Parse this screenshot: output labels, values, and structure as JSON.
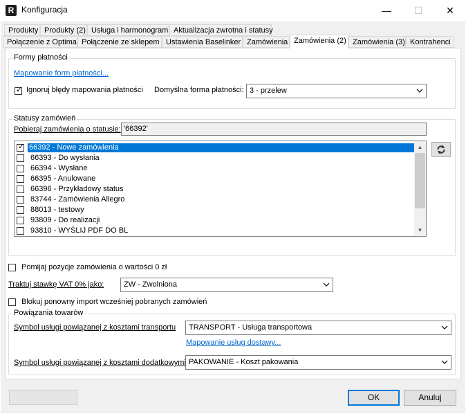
{
  "window": {
    "title": "Konfiguracja",
    "app_icon_letter": "R",
    "minimize_symbol": "—",
    "maximize_symbol": "☐",
    "close_symbol": "✕"
  },
  "tabs_row1": [
    "Produkty",
    "Produkty (2)",
    "Usługa i harmonogram",
    "Aktualizacja zwrotna i statusy"
  ],
  "tabs_row2": [
    "Połączenie z Optima",
    "Połączenie ze sklepem",
    "Ustawienia Baselinker",
    "Zamówienia",
    "Zamówienia (2)",
    "Zamówienia (3)",
    "Kontrahenci"
  ],
  "active_tab": "Zamówienia (2)",
  "payment_forms": {
    "group_title": "Formy płatności",
    "mapping_link": "Mapowanie form płatności...",
    "ignore_errors_label": "Ignoruj błędy mapowania płatności",
    "ignore_errors_checked": true,
    "default_form_label": "Domyślna forma płatności:",
    "default_form_value": "3 - przelew"
  },
  "order_statuses": {
    "group_title": "Statusy zamówień",
    "fetch_label": "Pobieraj zamówienia o statusie:",
    "fetch_value": "'66392'",
    "items": [
      {
        "label": "66392 - Nowe zamówienia",
        "checked": true,
        "selected": true
      },
      {
        "label": "66393 - Do wysłania",
        "checked": false,
        "selected": false
      },
      {
        "label": "66394 - Wysłane",
        "checked": false,
        "selected": false
      },
      {
        "label": "66395 - Anulowane",
        "checked": false,
        "selected": false
      },
      {
        "label": "66396 - Przykładowy status",
        "checked": false,
        "selected": false
      },
      {
        "label": "83744 - Zamówienia Allegro",
        "checked": false,
        "selected": false
      },
      {
        "label": "88013 - testowy",
        "checked": false,
        "selected": false
      },
      {
        "label": "93809 - Do realizacji",
        "checked": false,
        "selected": false
      },
      {
        "label": "93810 - WYŚLIJ PDF DO BL",
        "checked": false,
        "selected": false
      }
    ],
    "refresh_icon": "refresh-icon"
  },
  "options": {
    "skip_zero_label": "Pomijaj pozycje zamówienia o wartości 0 zł",
    "skip_zero_checked": false,
    "vat_label": "Traktuj stawkę VAT 0% jako:",
    "vat_value": "ZW - Zwolniona",
    "block_reimport_label": "Blokuj ponowny import wcześniej pobranych zamówień",
    "block_reimport_checked": false
  },
  "product_links": {
    "group_title": "Powiązania towarów",
    "transport_label": "Symbol usługi powiązanej z kosztami transportu",
    "transport_value": "TRANSPORT - Usługa transportowa",
    "delivery_mapping_link": "Mapowanie usług dostawy...",
    "extra_label": "Symbol usługi powiązanej z kosztami dodatkowymi",
    "extra_value": "PAKOWANIE - Koszt pakowania"
  },
  "footer": {
    "ok_label": "OK",
    "cancel_label": "Anuluj"
  },
  "colors": {
    "selection": "#0078d7",
    "link": "#0066cc",
    "dialog_bg": "#f0f0f0"
  }
}
